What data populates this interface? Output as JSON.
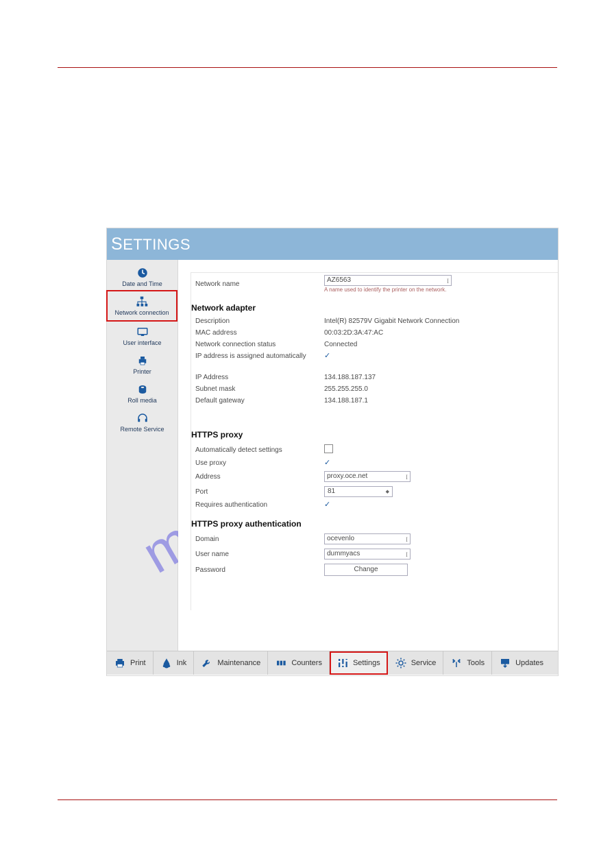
{
  "watermark": "manualshive.com",
  "header_title_pre": "S",
  "header_title_rest": "ETTINGS",
  "sidebar": {
    "items": [
      {
        "label": "Date and Time"
      },
      {
        "label": "Network connection"
      },
      {
        "label": "User interface"
      },
      {
        "label": "Printer"
      },
      {
        "label": "Roll media"
      },
      {
        "label": "Remote Service"
      }
    ]
  },
  "form": {
    "network_name_label": "Network name",
    "network_name_value": "AZ6563",
    "network_name_hint": "A name used to identify the printer on the network.",
    "adapter_section": "Network adapter",
    "description_label": "Description",
    "description_value": "Intel(R) 82579V Gigabit Network Connection",
    "mac_label": "MAC address",
    "mac_value": "00:03:2D:3A:47:AC",
    "conn_status_label": "Network connection status",
    "conn_status_value": "Connected",
    "ip_auto_label": "IP address is assigned automatically",
    "ip_addr_label": "IP Address",
    "ip_addr_value": "134.188.187.137",
    "subnet_label": "Subnet mask",
    "subnet_value": "255.255.255.0",
    "gateway_label": "Default gateway",
    "gateway_value": "134.188.187.1",
    "proxy_section": "HTTPS proxy",
    "auto_detect_label": "Automatically detect settings",
    "use_proxy_label": "Use proxy",
    "proxy_addr_label": "Address",
    "proxy_addr_value": "proxy.oce.net",
    "proxy_port_label": "Port",
    "proxy_port_value": "81",
    "requires_auth_label": "Requires authentication",
    "auth_section": "HTTPS proxy authentication",
    "domain_label": "Domain",
    "domain_value": "ocevenlo",
    "user_label": "User name",
    "user_value": "dummyacs",
    "pwd_label": "Password",
    "change_button": "Change"
  },
  "tabs": [
    {
      "label": "Print"
    },
    {
      "label": "Ink"
    },
    {
      "label": "Maintenance"
    },
    {
      "label": "Counters"
    },
    {
      "label": "Settings"
    },
    {
      "label": "Service"
    },
    {
      "label": "Tools"
    },
    {
      "label": "Updates"
    }
  ]
}
